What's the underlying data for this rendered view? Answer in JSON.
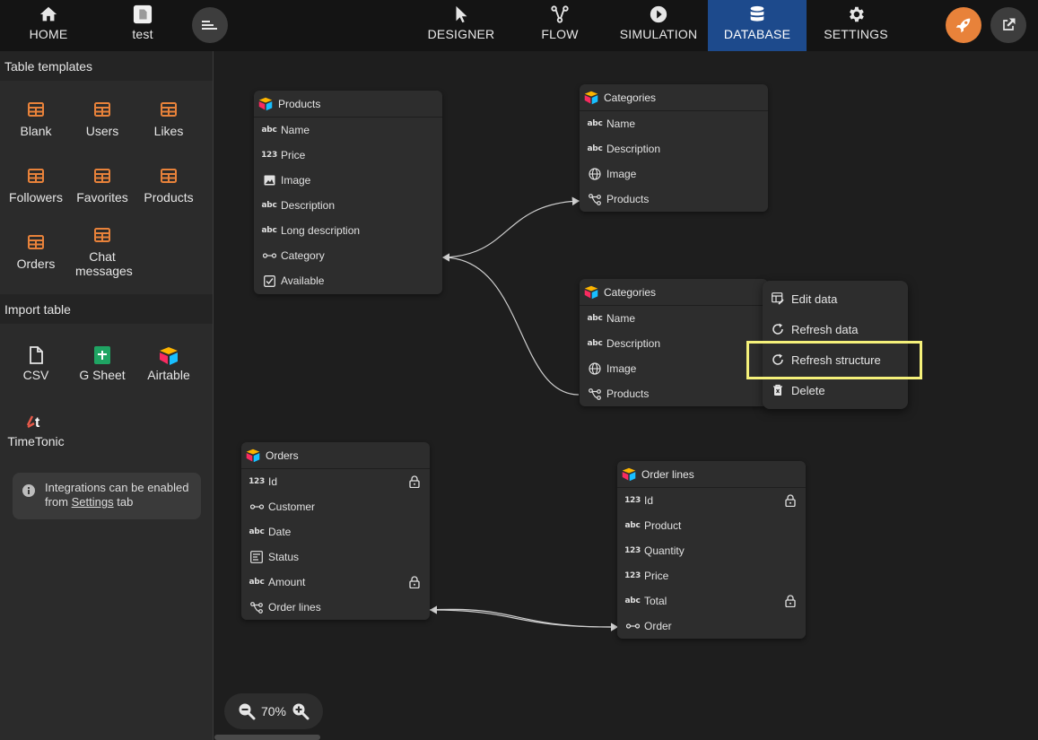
{
  "topbar": {
    "home_label": "HOME",
    "project_label": "test",
    "nav": [
      {
        "label": "DESIGNER",
        "icon": "cursor-icon"
      },
      {
        "label": "FLOW",
        "icon": "flow-icon"
      },
      {
        "label": "SIMULATION",
        "icon": "play-icon"
      },
      {
        "label": "DATABASE",
        "icon": "database-icon",
        "active": true
      },
      {
        "label": "SETTINGS",
        "icon": "gear-icon"
      }
    ],
    "accent_color": "#e8823a",
    "active_color": "#1d4a8c"
  },
  "sidebar": {
    "templates_header": "Table templates",
    "templates": [
      "Blank",
      "Users",
      "Likes",
      "Followers",
      "Favorites",
      "Products",
      "Orders",
      "Chat messages"
    ],
    "import_header": "Import table",
    "imports": [
      "CSV",
      "G Sheet",
      "Airtable",
      "TimeTonic"
    ],
    "info_text_1": "Integrations can be enabled",
    "info_text_2a": "from",
    "info_link": "Settings",
    "info_text_2b": "tab"
  },
  "tables": {
    "products": {
      "title": "Products",
      "fields": [
        "Name",
        "Price",
        "Image",
        "Description",
        "Long description",
        "Category",
        "Available"
      ]
    },
    "categories1": {
      "title": "Categories",
      "fields": [
        "Name",
        "Description",
        "Image",
        "Products"
      ]
    },
    "categories2": {
      "title": "Categories",
      "fields": [
        "Name",
        "Description",
        "Image",
        "Products"
      ]
    },
    "orders": {
      "title": "Orders",
      "fields": [
        "Id",
        "Customer",
        "Date",
        "Status",
        "Amount",
        "Order lines"
      ]
    },
    "orderlines": {
      "title": "Order lines",
      "fields": [
        "Id",
        "Product",
        "Quantity",
        "Price",
        "Total",
        "Order"
      ]
    }
  },
  "context_menu": {
    "items": [
      "Edit data",
      "Refresh data",
      "Refresh structure",
      "Delete"
    ],
    "highlight_color": "#f5f17a"
  },
  "zoom": {
    "level": "70%"
  }
}
